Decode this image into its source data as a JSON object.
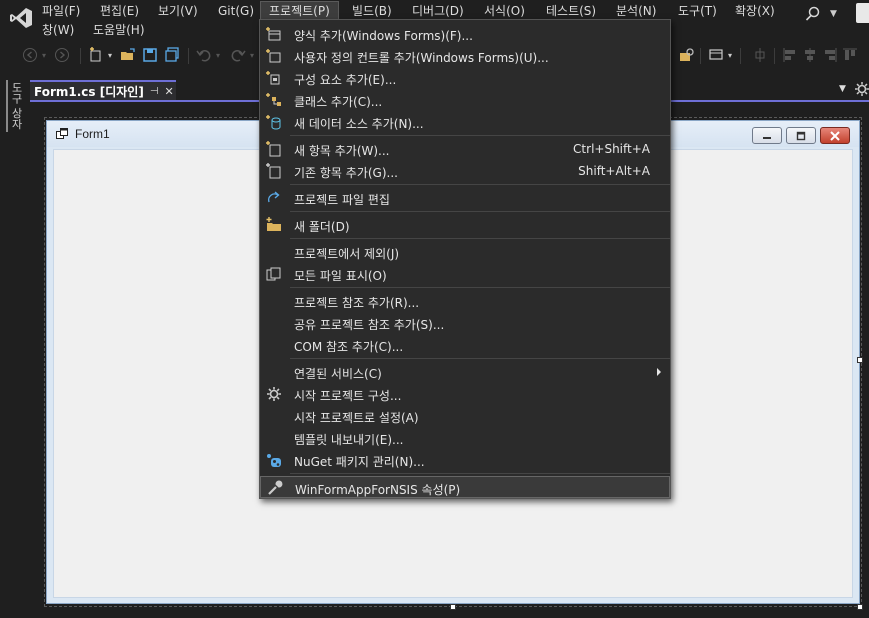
{
  "menubar": {
    "row1": [
      "파일(F)",
      "편집(E)",
      "보기(V)",
      "Git(G)",
      "프로젝트(P)",
      "빌드(B)",
      "디버그(D)",
      "서식(O)",
      "테스트(S)",
      "분석(N)",
      "도구(T)",
      "확장(X)"
    ],
    "row2": [
      "창(W)",
      "도움말(H)"
    ],
    "active": "프로젝트(P)"
  },
  "icons": {
    "logo": "visual-studio-logo-icon",
    "search": "search-icon"
  },
  "toolbox": {
    "label": "도구 상자"
  },
  "document_tab": {
    "title": "Form1.cs [디자인]",
    "pin_glyph": "⊣",
    "close_glyph": "✕"
  },
  "form": {
    "title": "Form1"
  },
  "project_menu": {
    "groups": [
      [
        {
          "label": "양식 추가(Windows Forms)(F)...",
          "icon": "add-form-icon"
        },
        {
          "label": "사용자 정의 컨트롤 추가(Windows Forms)(U)...",
          "icon": "add-user-control-icon"
        },
        {
          "label": "구성 요소 추가(E)...",
          "icon": "add-component-icon"
        },
        {
          "label": "클래스 추가(C)...",
          "icon": "add-class-icon"
        },
        {
          "label": "새 데이터 소스 추가(N)...",
          "icon": "add-data-source-icon"
        }
      ],
      [
        {
          "label": "새 항목 추가(W)...",
          "shortcut": "Ctrl+Shift+A",
          "icon": "new-item-icon"
        },
        {
          "label": "기존 항목 추가(G)...",
          "shortcut": "Shift+Alt+A",
          "icon": "existing-item-icon"
        }
      ],
      [
        {
          "label": "프로젝트 파일 편집",
          "icon": "edit-project-file-icon"
        }
      ],
      [
        {
          "label": "새 폴더(D)",
          "icon": "new-folder-icon"
        }
      ],
      [
        {
          "label": "프로젝트에서 제외(J)",
          "icon": ""
        },
        {
          "label": "모든 파일 표시(O)",
          "icon": "show-all-files-icon"
        }
      ],
      [
        {
          "label": "프로젝트 참조 추가(R)...",
          "icon": ""
        },
        {
          "label": "공유 프로젝트 참조 추가(S)...",
          "icon": ""
        },
        {
          "label": "COM 참조 추가(C)...",
          "icon": ""
        }
      ],
      [
        {
          "label": "연결된 서비스(C)",
          "submenu": true,
          "icon": ""
        },
        {
          "label": "시작 프로젝트 구성...",
          "icon": "gear-icon"
        },
        {
          "label": "시작 프로젝트로 설정(A)",
          "icon": ""
        },
        {
          "label": "템플릿 내보내기(E)...",
          "icon": ""
        },
        {
          "label": "NuGet 패키지 관리(N)...",
          "icon": "nuget-icon"
        }
      ],
      [
        {
          "label": "WinFormAppForNSIS 속성(P)",
          "icon": "wrench-icon",
          "highlighted": true
        }
      ]
    ]
  },
  "colors": {
    "accent": "#6e6fd6",
    "menu_bg": "#2b2b2b",
    "ide_bg": "#1f1f1f",
    "form_client": "#f0f0f0"
  }
}
